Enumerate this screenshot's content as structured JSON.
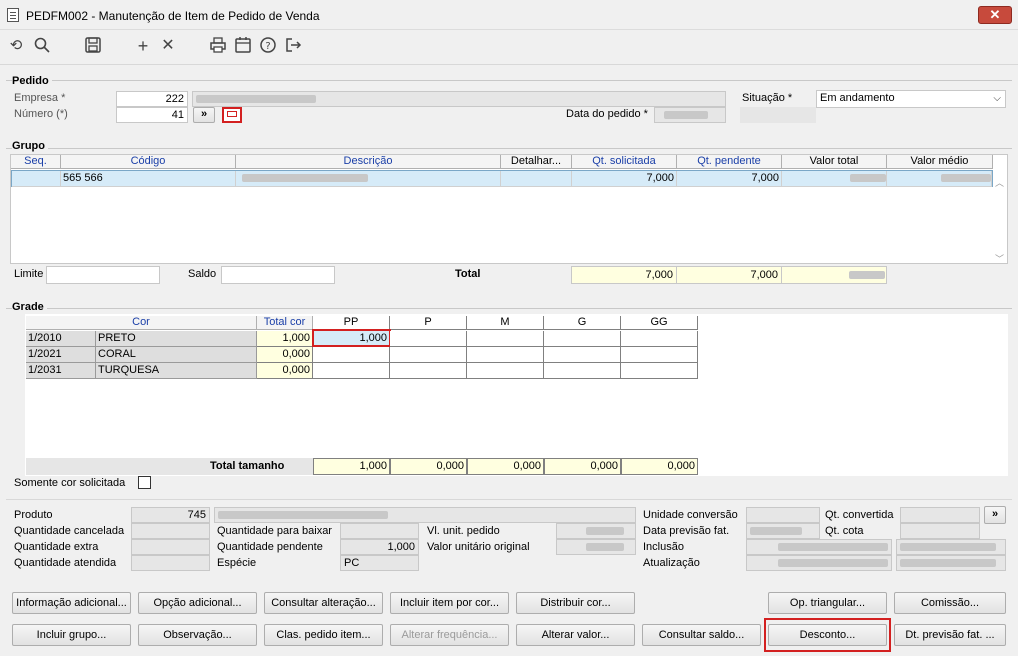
{
  "window": {
    "title": "PEDFM002 - Manutenção de Item de Pedido de Venda",
    "close": "✕"
  },
  "pedido": {
    "section": "Pedido",
    "empresa_label": "Empresa *",
    "empresa_value": "222",
    "numero_label": "Número (*)",
    "numero_value": "41",
    "nav_btn": "»",
    "data_label": "Data do pedido *",
    "situacao_label": "Situação *",
    "situacao_value": "Em andamento"
  },
  "grupo": {
    "section": "Grupo",
    "columns": [
      "Seq.",
      "Código",
      "Descrição",
      "Detalhar...",
      "Qt. solicitada",
      "Qt. pendente",
      "Valor total",
      "Valor médio"
    ],
    "row": {
      "codigo": "565 566",
      "qt_solicitada": "7,000",
      "qt_pendente": "7,000"
    },
    "limite_label": "Limite",
    "saldo_label": "Saldo",
    "total_label": "Total",
    "total_solicitada": "7,000",
    "total_pendente": "7,000"
  },
  "grade": {
    "section": "Grade",
    "col_cor": "Cor",
    "col_total": "Total cor",
    "sizes": [
      "PP",
      "P",
      "M",
      "G",
      "GG"
    ],
    "rows": [
      {
        "code": "1/2010",
        "name": "PRETO",
        "total": "1,000",
        "pp": "1,000"
      },
      {
        "code": "1/2021",
        "name": "CORAL",
        "total": "0,000",
        "pp": ""
      },
      {
        "code": "1/2031",
        "name": "TURQUESA",
        "total": "0,000",
        "pp": ""
      }
    ],
    "total_tamanho_label": "Total tamanho",
    "totals": [
      "1,000",
      "0,000",
      "0,000",
      "0,000",
      "0,000"
    ],
    "somente_label": "Somente cor solicitada"
  },
  "info": {
    "produto_label": "Produto",
    "produto_value": "745",
    "qt_cancelada": "Quantidade cancelada",
    "qt_extra": "Quantidade extra",
    "qt_atendida": "Quantidade atendida",
    "qt_baixar": "Quantidade para baixar",
    "qt_pendente": "Quantidade pendente",
    "qt_pendente_value": "1,000",
    "especie_label": "Espécie",
    "especie_value": "PC",
    "vl_unit": "Vl. unit. pedido",
    "vl_original": "Valor unitário original",
    "unidade_conv": "Unidade conversão",
    "dt_prev": "Data previsão fat.",
    "inclusao": "Inclusão",
    "atualizacao": "Atualização",
    "qt_convertida": "Qt. convertida",
    "qt_cota": "Qt. cota",
    "nav_btn": "»"
  },
  "buttons": {
    "info_adicional": "Informação adicional...",
    "opcao_adicional": "Opção adicional...",
    "consultar_alteracao": "Consultar alteração...",
    "incluir_item_cor": "Incluir item por cor...",
    "distribuir_cor": "Distribuir cor...",
    "op_triangular": "Op. triangular...",
    "comissao": "Comissão...",
    "incluir_grupo": "Incluir grupo...",
    "observacao": "Observação...",
    "clas_pedido": "Clas. pedido item...",
    "alterar_frequencia": "Alterar frequência...",
    "alterar_valor": "Alterar valor...",
    "consultar_saldo": "Consultar saldo...",
    "desconto": "Desconto...",
    "dt_previsao": "Dt. previsão fat. ..."
  }
}
